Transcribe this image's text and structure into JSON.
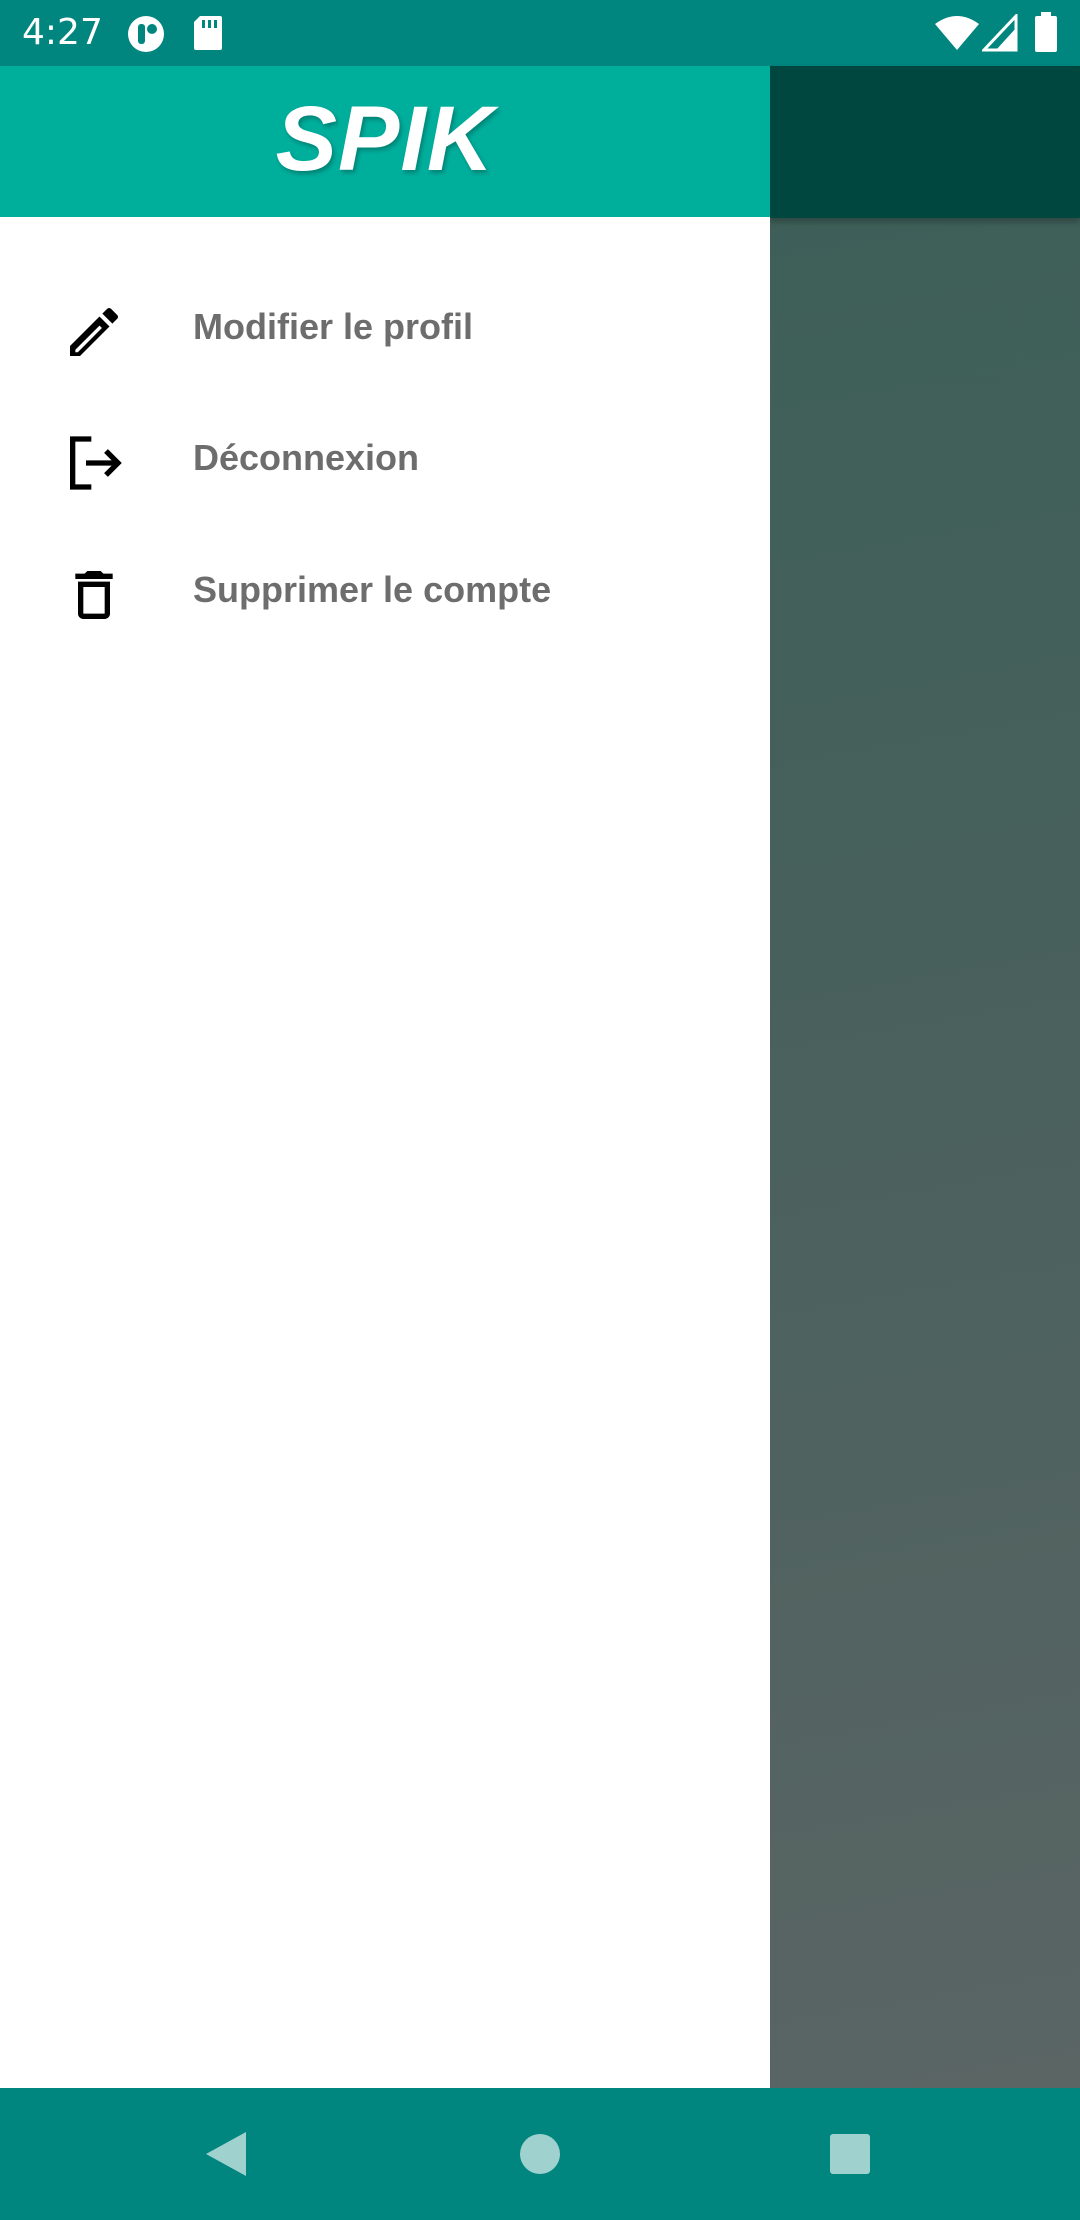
{
  "status_bar": {
    "time": "4:27",
    "icons": [
      "notification-app-icon",
      "sd-card-icon",
      "wifi-icon",
      "signal-icon",
      "battery-icon"
    ]
  },
  "drawer": {
    "brand": "SPIK",
    "header_color": "#00ae9c",
    "items": [
      {
        "icon": "pencil-icon",
        "label": "Modifier le profil"
      },
      {
        "icon": "logout-icon",
        "label": "Déconnexion"
      },
      {
        "icon": "trash-icon",
        "label": "Supprimer le compte"
      }
    ]
  },
  "nav_bar": {
    "buttons": [
      "back-icon",
      "home-icon",
      "recents-icon"
    ]
  },
  "colors": {
    "status_bar": "#00857f",
    "toolbar_dim": "#004740",
    "label_text": "#6d6d6d"
  }
}
